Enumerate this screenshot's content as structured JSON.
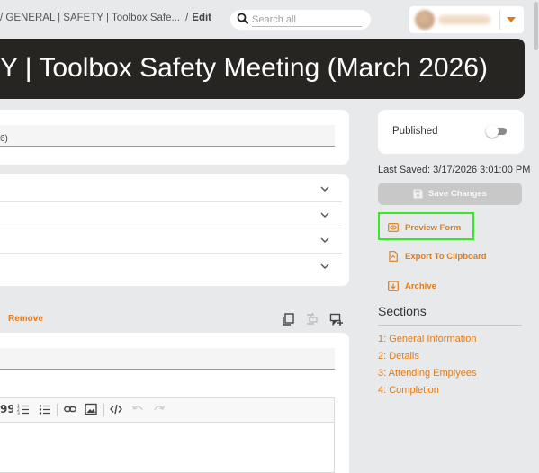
{
  "header": {
    "breadcrumb": "/ GENERAL | SAFETY | Toolbox Safe...",
    "breadcrumb_current": "Edit",
    "search_placeholder": "Search all"
  },
  "banner": {
    "title": "Y | Toolbox Safety Meeting (March 2026)"
  },
  "form": {
    "name_field_value": "6)"
  },
  "editor_section": {
    "remove_label": "Remove"
  },
  "side": {
    "published_label": "Published",
    "last_saved": "Last Saved: 3/17/2026 3:01:00 PM",
    "save_changes": "Save Changes",
    "preview_form": "Preview Form",
    "export_clipboard": "Export To Clipboard",
    "archive": "Archive"
  },
  "sections": {
    "heading": "Sections",
    "items": [
      "1: General Information",
      "2: Details",
      "3: Attending Emplyees",
      "4: Completion"
    ]
  },
  "colors": {
    "accent": "#e07b1a",
    "banner_bg": "#272522",
    "highlight": "#39e62a"
  }
}
